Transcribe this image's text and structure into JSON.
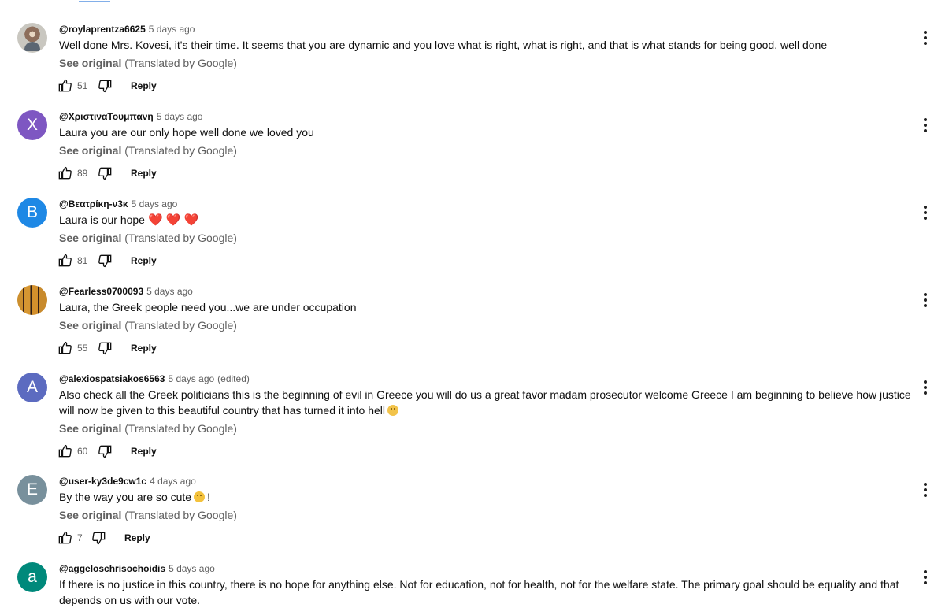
{
  "comments": [
    {
      "author": "@roylaprentza6625",
      "time": "5 days ago",
      "edited": "",
      "text": "Well done Mrs. Kovesi, it's their time. It seems that you are dynamic and you love what is right, what is right, and that is what stands for being good, well done",
      "translation_label": "See original",
      "translation_note": "(Translated by Google)",
      "likes": "51",
      "reply": "Reply",
      "avatar_letter": "",
      "avatar_color": "#c9c7c0"
    },
    {
      "author": "@ΧριστιναΤουμπανη",
      "time": "5 days ago",
      "edited": "",
      "text": "Laura you are our only hope well done we loved you",
      "translation_label": "See original",
      "translation_note": "(Translated by Google)",
      "likes": "89",
      "reply": "Reply",
      "avatar_letter": "X",
      "avatar_color": "#7e57c2"
    },
    {
      "author": "@Βεατρίκη-ν3κ",
      "time": "5 days ago",
      "edited": "",
      "text": "Laura is our hope",
      "text_suffix": "❤️ ❤️ ❤️",
      "translation_label": "See original",
      "translation_note": "(Translated by Google)",
      "likes": "81",
      "reply": "Reply",
      "avatar_letter": "B",
      "avatar_color": "#1e88e5"
    },
    {
      "author": "@Fearless0700093",
      "time": "5 days ago",
      "edited": "",
      "text": "Laura, the Greek people need you...we are under occupation",
      "translation_label": "See original",
      "translation_note": "(Translated by Google)",
      "likes": "55",
      "reply": "Reply",
      "avatar_letter": "",
      "avatar_color": "#cc8f2e"
    },
    {
      "author": "@alexiospatsiakos6563",
      "time": "5 days ago",
      "edited": "(edited)",
      "text": "Also check all the Greek politicians this is the beginning of evil in Greece you will do us a great favor madam prosecutor welcome Greece I am beginning to believe how justice will now be given to this beautiful country that has turned it into hell",
      "translation_label": "See original",
      "translation_note": "(Translated by Google)",
      "likes": "60",
      "reply": "Reply",
      "avatar_letter": "A",
      "avatar_color": "#5c6bc0"
    },
    {
      "author": "@user-ky3de9cw1c",
      "time": "4 days ago",
      "edited": "",
      "text": "By the way you are so cute",
      "text_suffix": "!",
      "translation_label": "See original",
      "translation_note": "(Translated by Google)",
      "likes": "7",
      "reply": "Reply",
      "avatar_letter": "E",
      "avatar_color": "#78909c"
    },
    {
      "author": "@aggeloschrisochoidis",
      "time": "5 days ago",
      "edited": "",
      "text": "If there is no justice in this country, there is no hope for anything else. Not for education, not for health, not for the welfare state. The primary goal should be equality and that depends on us with our vote.",
      "avatar_letter": "a",
      "avatar_color": "#00897b"
    }
  ],
  "icons": {
    "like": "thumb-up-icon",
    "dislike": "thumb-down-icon",
    "more": "more-vertical-icon",
    "emoji_smile": "smiling-face-icon",
    "emoji_sad": "sad-face-icon"
  }
}
